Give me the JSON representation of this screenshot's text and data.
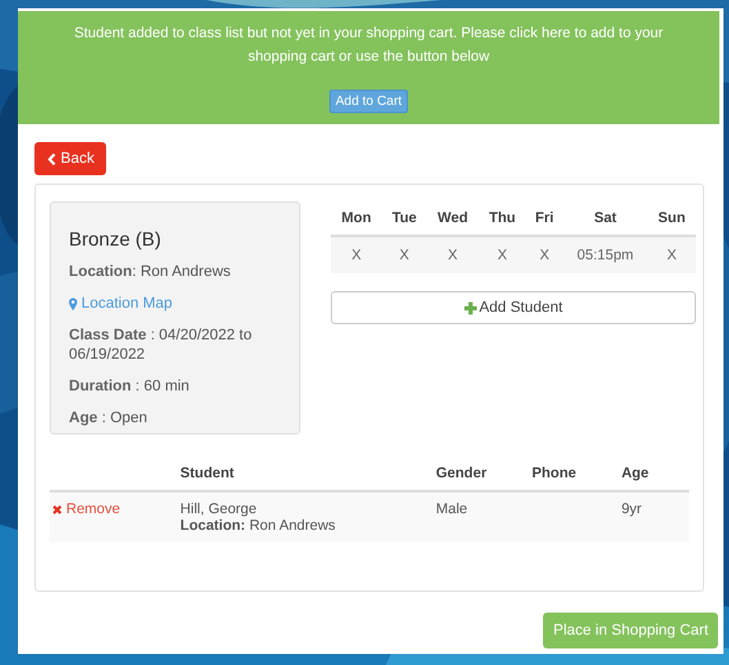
{
  "alert": {
    "message": "Student added to class list but not yet in your shopping cart. Please click here to add to your shopping cart or use the button below",
    "button": "Add to Cart"
  },
  "back_button": "Back",
  "class_info": {
    "title": "Bronze (B)",
    "details": [
      {
        "kind": "field",
        "text": "**Location**: Ron Andrews"
      },
      {
        "kind": "link",
        "text": "Location Map"
      },
      {
        "kind": "field",
        "text": "**Class Date** : 04/20/2022 to 06/19/2022"
      },
      {
        "kind": "field",
        "text": "**Duration** : 60 min"
      },
      {
        "kind": "field",
        "text": "**Age** : Open"
      }
    ]
  },
  "schedule": [
    {
      "day": "Mon",
      "time": "X"
    },
    {
      "day": "Tue",
      "time": "X"
    },
    {
      "day": "Wed",
      "time": "X"
    },
    {
      "day": "Thu",
      "time": "X"
    },
    {
      "day": "Fri",
      "time": "X"
    },
    {
      "day": "Sat",
      "time": "05:15pm"
    },
    {
      "day": "Sun",
      "time": "X"
    }
  ],
  "add_student_button": "Add Student",
  "students": {
    "columns": [
      "Student",
      "Gender",
      "Phone",
      "Age"
    ],
    "rows": [
      {
        "action": "Remove",
        "student": "Hill, George",
        "location": "**Location:** Ron Andrews",
        "gender": "Male",
        "age": "9yr"
      }
    ]
  },
  "place_button": "Place in Shopping Cart"
}
